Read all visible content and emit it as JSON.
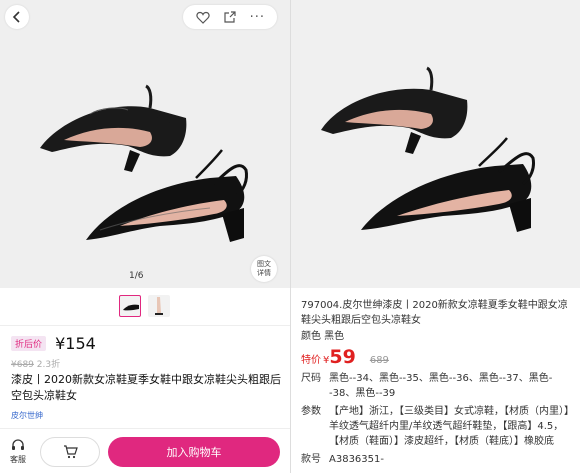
{
  "left": {
    "pager": "1/6",
    "detail_chip": [
      "图文",
      "详情"
    ],
    "promo_tag": "折后价",
    "price_now": "¥154",
    "price_orig": "¥689",
    "discount": "2.3折",
    "title": "漆皮丨2020新款女凉鞋夏季女鞋中跟女凉鞋尖头粗跟后空包头凉鞋女",
    "brand": "皮尔世绅",
    "service_label": "客服",
    "add_cart_label": "加入购物车"
  },
  "right": {
    "title": "797004.皮尔世绅漆皮丨2020新款女凉鞋夏季女鞋中跟女凉鞋尖头粗跟后空包头凉鞋女",
    "color_line": "颜色 黑色",
    "price_label": "特价",
    "currency": "¥",
    "price": "59",
    "old_price": "689",
    "size_key": "尺码",
    "size_value": "黑色--34、黑色--35、黑色--36、黑色--37、黑色--38、黑色--39",
    "param_key": "参数",
    "param_value": "【产地】浙江，【三级类目】女式凉鞋，【材质（内里）】羊纹透气超纤内里/羊纹透气超纤鞋垫，【跟高】4.5，【材质（鞋面）】漆皮超纤，【材质（鞋底）】橡胶底",
    "sku_key": "款号",
    "sku_value": "A3836351-"
  },
  "colors": {
    "accent": "#e0287f",
    "sale_red": "#e02020",
    "link_blue": "#3366cc"
  },
  "icons": [
    "chevron-left-icon",
    "heart-icon",
    "share-icon",
    "more-icon",
    "headset-icon",
    "cart-icon"
  ]
}
